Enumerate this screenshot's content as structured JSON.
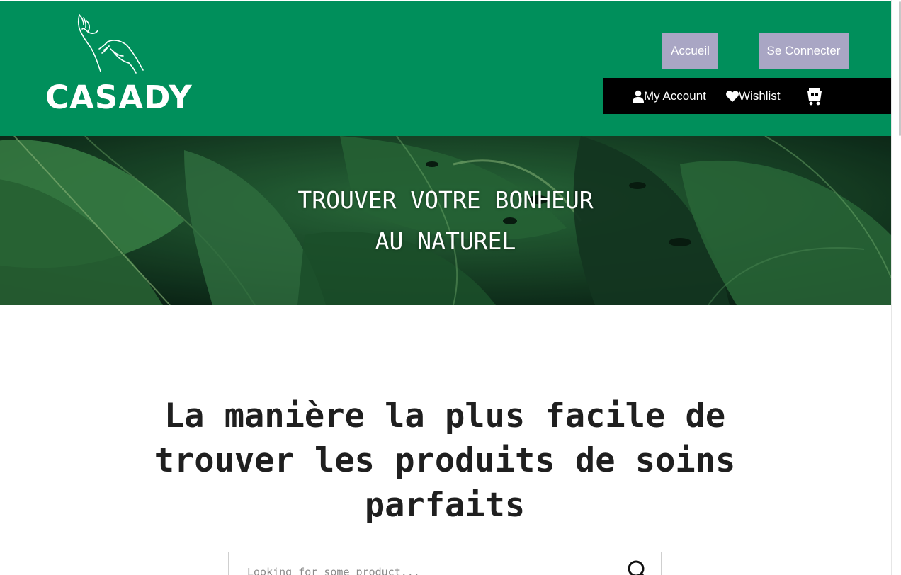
{
  "brand": {
    "name": "CASADY",
    "color": "#008f5b"
  },
  "header": {
    "nav_buttons": [
      {
        "label": "Accueil"
      },
      {
        "label": "Se Connecter"
      }
    ],
    "account_bar": {
      "my_account": "My Account",
      "wishlist": "Wishlist",
      "cart_icon": "cart-icon"
    }
  },
  "hero": {
    "line1": "TROUVER VOTRE BONHEUR",
    "line2": "AU NATUREL"
  },
  "main": {
    "heading_line1": "La manière la plus facile de",
    "heading_line2": "trouver les produits de soins",
    "heading_line3": "parfaits"
  },
  "search": {
    "placeholder": "Looking for some product...",
    "icon": "search-icon"
  },
  "colors": {
    "nav_button_bg": "#a9a6c4",
    "account_bar_bg": "#000000"
  }
}
